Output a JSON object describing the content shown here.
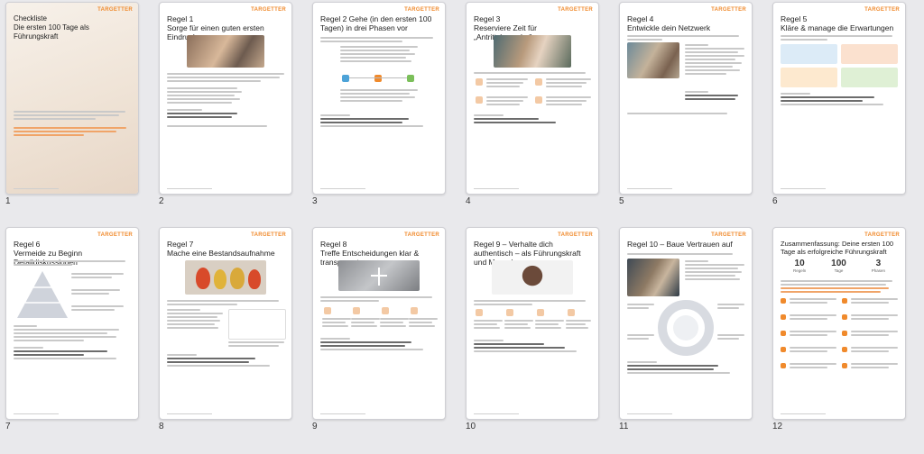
{
  "brand": "TARGETTER",
  "pages": [
    {
      "num": "1",
      "title": "Checkliste\nDie ersten 100 Tage als Führungskraft"
    },
    {
      "num": "2",
      "title": "Regel 1\nSorge für einen guten ersten Eindruck"
    },
    {
      "num": "3",
      "title": "Regel 2\nGehe (in den ersten 100 Tagen) in drei Phasen vor"
    },
    {
      "num": "4",
      "title": "Regel 3\nReserviere Zeit für „Antrittsbesuche\""
    },
    {
      "num": "5",
      "title": "Regel 4\nEntwickle dein Netzwerk"
    },
    {
      "num": "6",
      "title": "Regel 5\nKläre & manage die Erwartungen"
    },
    {
      "num": "7",
      "title": "Regel 6\nVermeide zu Beginn Detaildiskussionen"
    },
    {
      "num": "8",
      "title": "Regel 7\nMache eine Bestandsaufnahme"
    },
    {
      "num": "9",
      "title": "Regel 8\nTreffe Entscheidungen klar & transparent"
    },
    {
      "num": "10",
      "title": "Regel 9 – Verhalte dich authentisch – als Führungskraft und Mensch"
    },
    {
      "num": "11",
      "title": "Regel 10 – Baue Vertrauen auf"
    },
    {
      "num": "12",
      "title": "Zusammenfassung: Deine ersten 100 Tage als erfolgreiche Führungskraft"
    }
  ],
  "summary_stats": [
    {
      "value": "10",
      "label": "Regeln"
    },
    {
      "value": "100",
      "label": "Tage"
    },
    {
      "value": "3",
      "label": "Phasen"
    }
  ],
  "colors": {
    "accent": "#f08a2c",
    "background": "#e9e9ec"
  }
}
